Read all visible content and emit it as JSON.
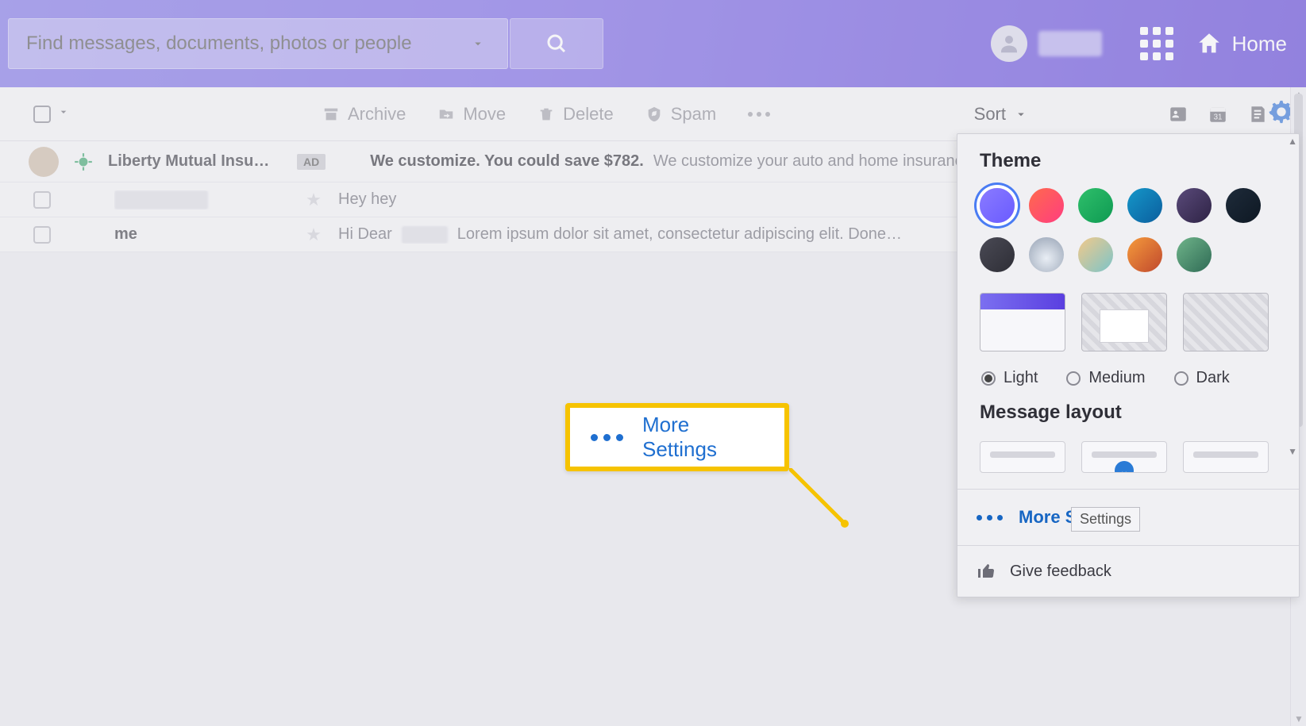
{
  "search": {
    "placeholder": "Find messages, documents, photos or people"
  },
  "header": {
    "home_label": "Home"
  },
  "toolbar": {
    "archive": "Archive",
    "move": "Move",
    "delete": "Delete",
    "spam": "Spam",
    "sort": "Sort"
  },
  "messages": {
    "ad": {
      "sender": "Liberty Mutual Insu…",
      "ad_pill": "AD",
      "subject_bold": "We customize. You could save $782.",
      "subject_rest": "We customize your auto and home insurance"
    },
    "row1": {
      "subject": "Hey hey"
    },
    "row2": {
      "sender": "me",
      "subject_prefix": "Hi   Dear",
      "subject_rest": "Lorem ipsum dolor sit amet, consectetur adipiscing elit. Done…"
    }
  },
  "panel": {
    "theme_heading": "Theme",
    "modes": {
      "light": "Light",
      "medium": "Medium",
      "dark": "Dark"
    },
    "layout_heading": "Message layout",
    "more_settings": "More Settings",
    "tooltip": "Settings",
    "feedback": "Give feedback",
    "swatches": [
      "linear-gradient(135deg,#8a7bff,#6a5bff)",
      "linear-gradient(135deg,#ff6a4d,#ff3d7f)",
      "linear-gradient(135deg,#2fbf6b,#0e9a52)",
      "linear-gradient(135deg,#1597c9,#0b5e9e)",
      "linear-gradient(135deg,#5a4a7a,#2e2345)",
      "linear-gradient(135deg,#1e2b3a,#0e1823)",
      "linear-gradient(135deg,#4a4a55,#2e2e36)",
      "radial-gradient(circle at 50% 60%,#e9eef5,#95a1b3)",
      "linear-gradient(135deg,#f2c98a,#7cc4c9)",
      "linear-gradient(135deg,#f59b3c,#c0482d)",
      "linear-gradient(135deg,#6fb48a,#2f6b55)"
    ]
  },
  "callout": {
    "label": "More Settings"
  },
  "calendar_badge": "31"
}
